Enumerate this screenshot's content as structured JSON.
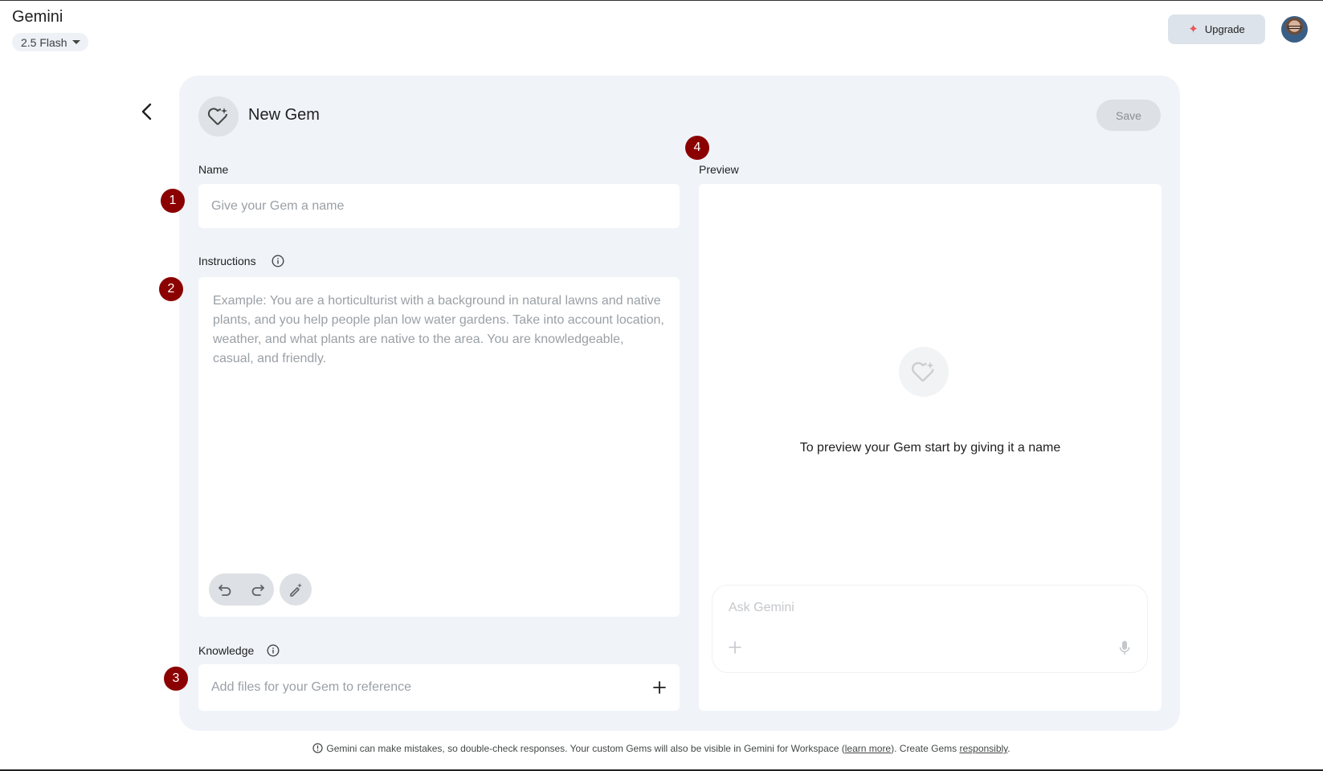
{
  "header": {
    "app_title": "Gemini",
    "model": "2.5 Flash",
    "upgrade_label": "Upgrade"
  },
  "gem_editor": {
    "title": "New Gem",
    "save_label": "Save",
    "name": {
      "label": "Name",
      "placeholder": "Give your Gem a name"
    },
    "instructions": {
      "label": "Instructions",
      "placeholder": "Example: You are a horticulturist with a background in natural lawns and native plants, and you help people plan low water gardens. Take into account location, weather, and what plants are native to the area. You are knowledgeable, casual, and friendly."
    },
    "knowledge": {
      "label": "Knowledge",
      "placeholder": "Add files for your Gem to reference"
    }
  },
  "preview": {
    "label": "Preview",
    "empty_message": "To preview your Gem start by giving it a name",
    "ask_placeholder": "Ask Gemini"
  },
  "markers": [
    "1",
    "2",
    "3",
    "4"
  ],
  "footer": {
    "text_before": "Gemini can make mistakes, so double-check responses. Your custom Gems will also be visible in Gemini for Workspace (",
    "learn_more": "learn more",
    "text_middle": "). Create Gems ",
    "responsibly": "responsibly",
    "text_after": "."
  },
  "colors": {
    "card_background": "#f0f4f9",
    "marker": "#8b0000",
    "upgrade_spark": "#e8575a"
  }
}
